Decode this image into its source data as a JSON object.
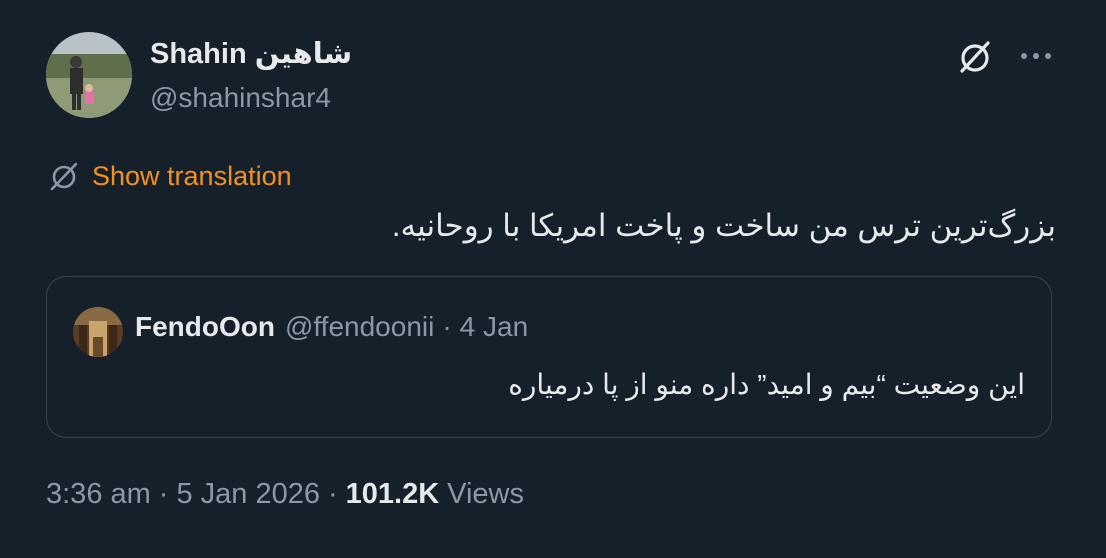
{
  "author": {
    "name": "Shahin شاهین",
    "handle": "@shahinshar4"
  },
  "icons": {
    "grok": "translate-slash-icon",
    "more": "more-dots-icon",
    "translate": "translate-slash-icon"
  },
  "translation": {
    "label": "Show translation"
  },
  "tweet": {
    "text": "بزرگ‌ترین ترس من ساخت و پاخت امریکا با روحانیه."
  },
  "quote": {
    "name": "FendoOon",
    "handle": "@ffendoonii",
    "separator": "·",
    "date": "4 Jan",
    "text": "این وضعیت “بیم و امید” داره منو از پا درمیاره"
  },
  "meta": {
    "time": "3:36 am",
    "separator": "·",
    "date": "5 Jan 2026",
    "views_count": "101.2K",
    "views_label": "Views"
  },
  "colors": {
    "background": "#15202b",
    "text": "#e7e9ea",
    "secondary": "#8b98a5",
    "accent": "#f4921f",
    "border": "#38444d"
  }
}
